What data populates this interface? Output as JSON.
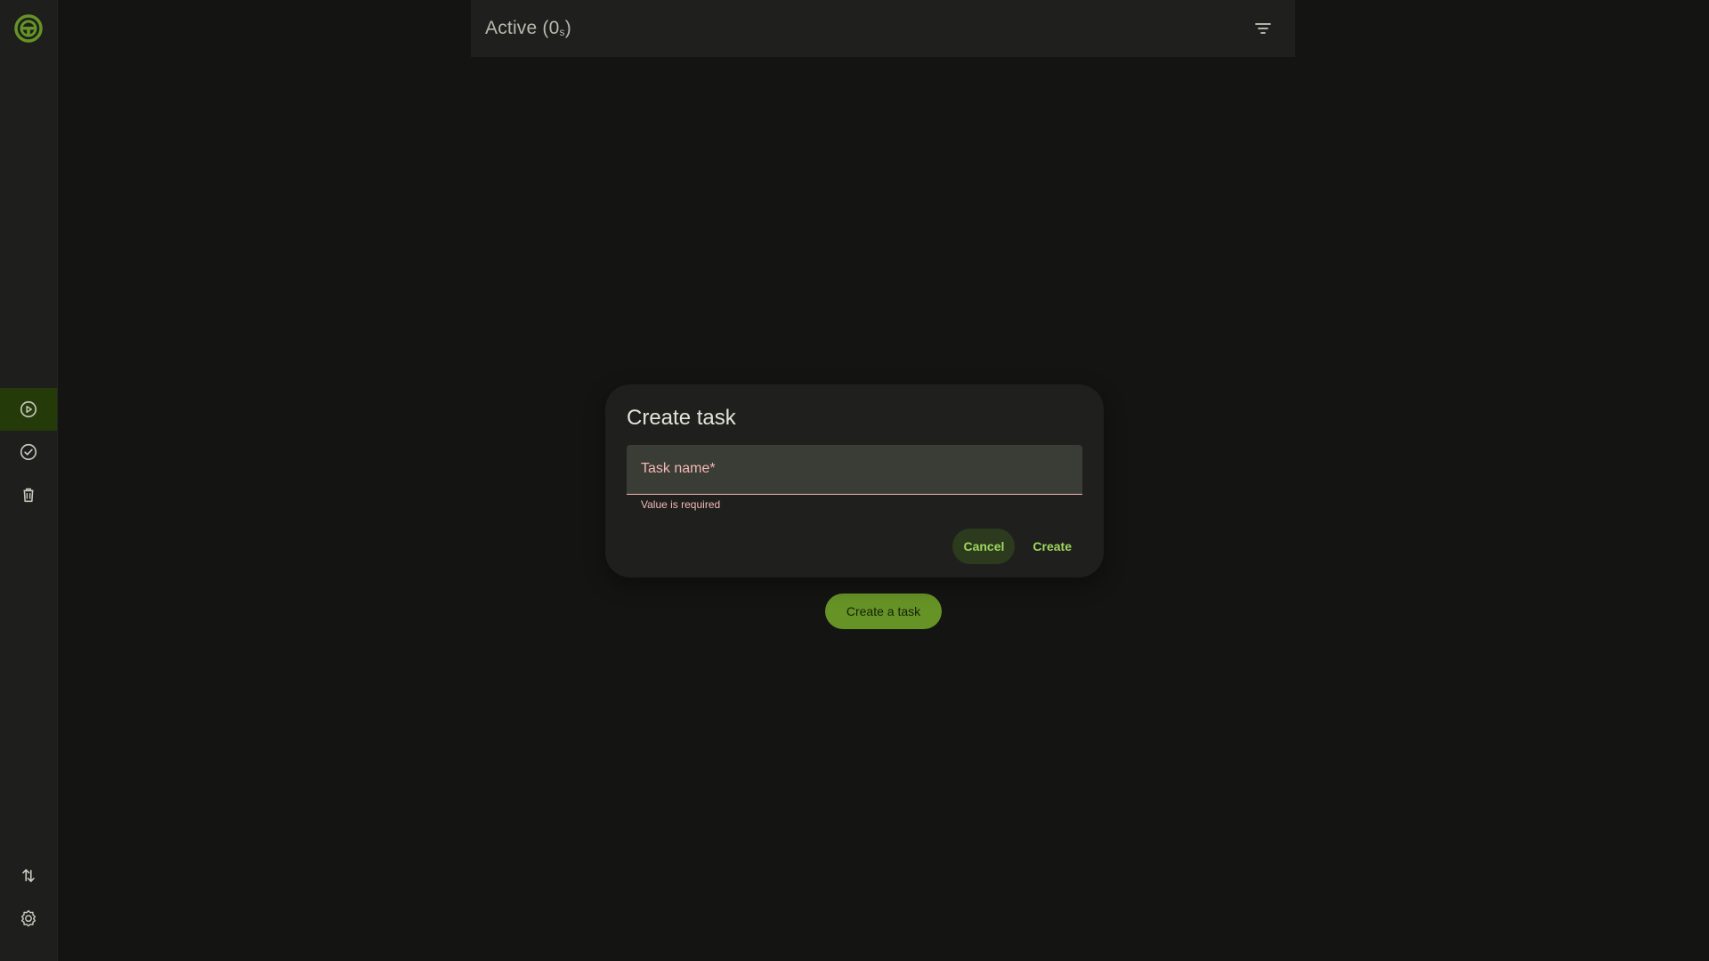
{
  "app": {
    "colors": {
      "background": "#141413",
      "sidebar": "#1e1f1c",
      "accent": "#669326",
      "accent_text": "#9fd75e",
      "error": "#f2b8b5"
    }
  },
  "sidebar": {
    "logo_icon": "steering-wheel-icon",
    "items": [
      {
        "name": "active-tasks",
        "icon": "play-circle-icon",
        "active": true
      },
      {
        "name": "completed-tasks",
        "icon": "check-circle-icon",
        "active": false
      },
      {
        "name": "deleted-tasks",
        "icon": "trash-icon",
        "active": false
      }
    ],
    "bottom_items": [
      {
        "name": "sync",
        "icon": "sort-arrows-icon"
      },
      {
        "name": "settings",
        "icon": "gear-icon"
      }
    ]
  },
  "header": {
    "title": "Active (0",
    "title_sub": "s",
    "title_end": ")",
    "filter_icon": "filter-icon"
  },
  "main": {
    "create_a_task_label": "Create a task"
  },
  "dialog": {
    "title": "Create task",
    "field": {
      "label": "Task name*",
      "value": "",
      "error": "Value is required"
    },
    "cancel_label": "Cancel",
    "create_label": "Create"
  }
}
